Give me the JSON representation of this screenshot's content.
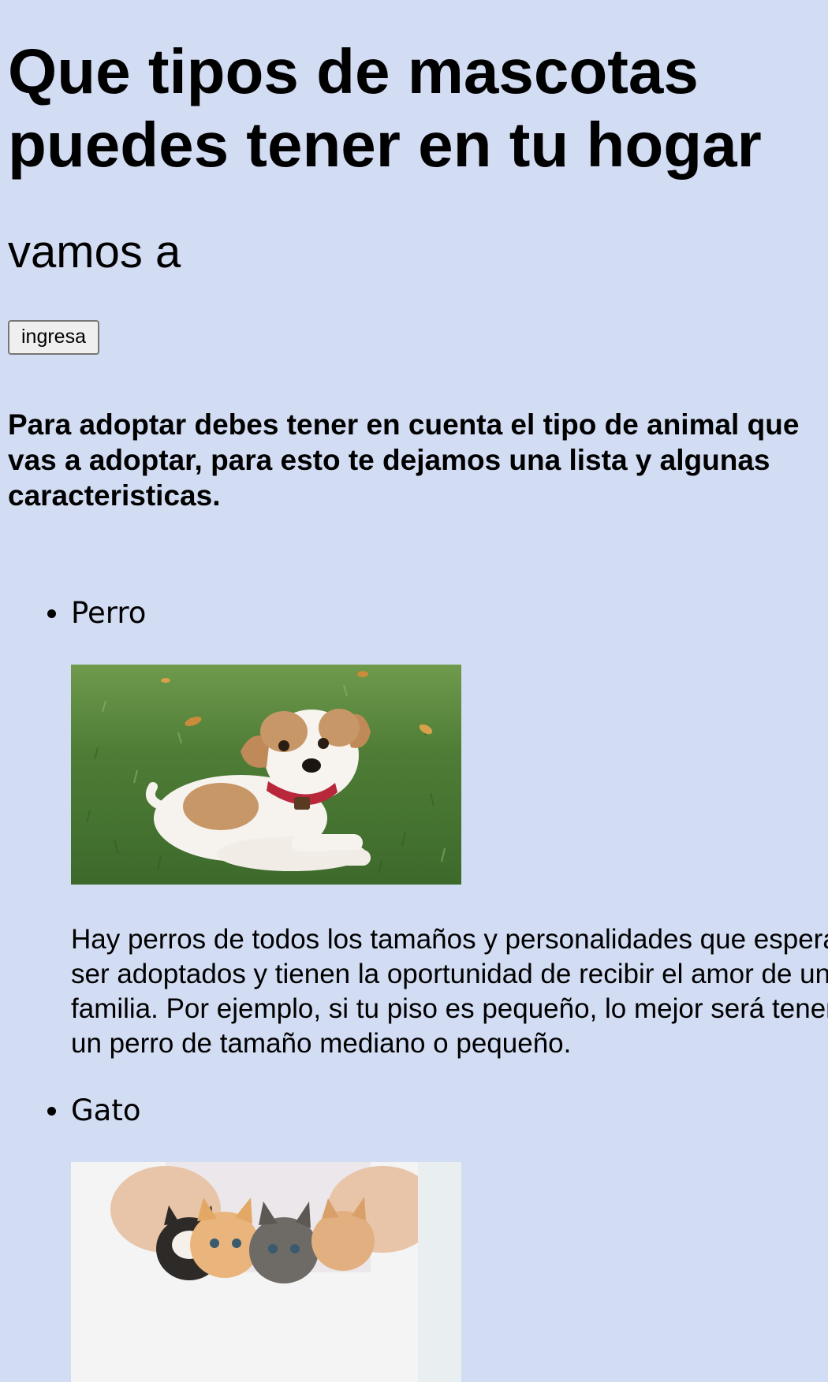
{
  "header": {
    "title": "Que tipos de mascotas puedes tener en tu hogar",
    "subtitle": "vamos a",
    "button_label": "ingresa"
  },
  "intro": "Para adoptar debes tener en cuenta el tipo de animal que vas a adoptar, para esto te dejamos una lista y algunas caracteristicas.",
  "pets": [
    {
      "name": "Perro",
      "description": "Hay perros de todos los tamaños y personalidades que esperan ser adoptados y tienen la oportunidad de recibir el amor de una familia. Por ejemplo, si tu piso es pequeño, lo mejor será tener un perro de tamaño mediano o pequeño."
    },
    {
      "name": "Gato"
    }
  ],
  "colors": {
    "background": "#d2dcf2",
    "button_bg": "#efefef",
    "button_border": "#767676"
  }
}
